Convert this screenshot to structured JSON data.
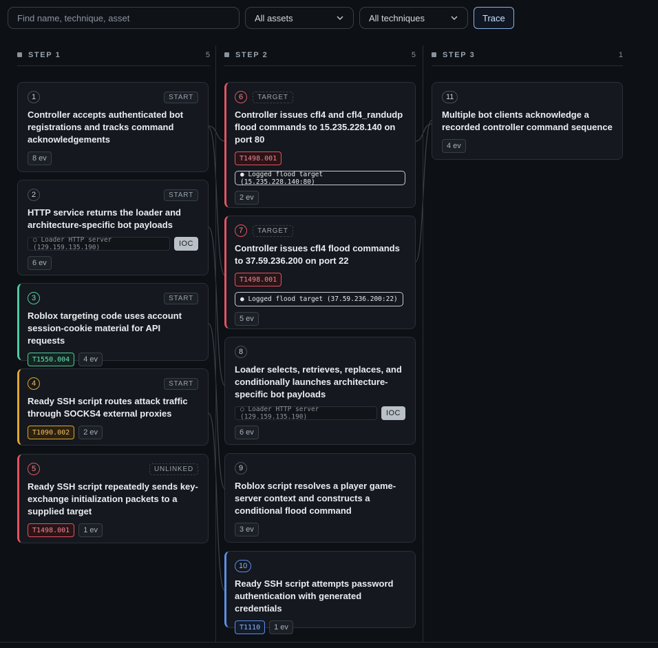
{
  "toolbar": {
    "search_placeholder": "Find  name, technique, asset",
    "assets_label": "All assets",
    "techniques_label": "All techniques",
    "trace_label": "Trace"
  },
  "columns": [
    {
      "label": "STEP 1",
      "count": "5"
    },
    {
      "label": "STEP 2",
      "count": "5"
    },
    {
      "label": "STEP 3",
      "count": "1"
    }
  ],
  "cards": [
    {
      "num": "1",
      "tag": "START",
      "title": "Controller accepts authenticated bot registrations and tracks command acknowledgements",
      "ev": "8 ev"
    },
    {
      "num": "2",
      "tag": "START",
      "title": "HTTP service returns the loader and architecture-specific bot payloads",
      "asset": "○ Loader HTTP server (129.159.135.190)",
      "ioc": "IOC",
      "ev": "6 ev"
    },
    {
      "num": "3",
      "tag": "START",
      "title": "Roblox targeting code uses account session-cookie material for API requests",
      "technique": "T1550.004",
      "ev": "4 ev"
    },
    {
      "num": "4",
      "tag": "START",
      "title": "Ready SSH script routes attack traffic through SOCKS4 external proxies",
      "technique": "T1090.002",
      "ev": "2 ev"
    },
    {
      "num": "5",
      "tag": "UNLINKED",
      "title": "Ready SSH script repeatedly sends key-exchange initialization packets to a supplied target",
      "technique": "T1498.001",
      "ev": "1 ev"
    },
    {
      "num": "6",
      "tag": "TARGET",
      "title": "Controller issues cfl4 and cfl4_randudp flood commands to 15.235.228.140 on port 80",
      "technique": "T1498.001",
      "logged": "● Logged flood target (15.235.228.140:80)",
      "ev": "2 ev"
    },
    {
      "num": "7",
      "tag": "TARGET",
      "title": "Controller issues cfl4 flood commands to 37.59.236.200 on port 22",
      "technique": "T1498.001",
      "logged": "● Logged flood target (37.59.236.200:22)",
      "ev": "5 ev"
    },
    {
      "num": "8",
      "title": "Loader selects, retrieves, replaces, and conditionally launches architecture-specific bot payloads",
      "asset": "○ Loader HTTP server (129.159.135.190)",
      "ioc": "IOC",
      "ev": "6 ev"
    },
    {
      "num": "9",
      "title": "Roblox script resolves a player game-server context and constructs a conditional flood command",
      "ev": "3 ev"
    },
    {
      "num": "10",
      "title": "Ready SSH script attempts password authentication with generated credentials",
      "technique": "T1110",
      "ev": "1 ev"
    },
    {
      "num": "11",
      "title": "Multiple bot clients acknowledge a recorded controller command sequence",
      "ev": "4 ev"
    }
  ],
  "colors": {
    "red": "#e2545f",
    "green": "#4ecba0",
    "amber": "#e0a72e",
    "blue": "#5b8fe8"
  }
}
